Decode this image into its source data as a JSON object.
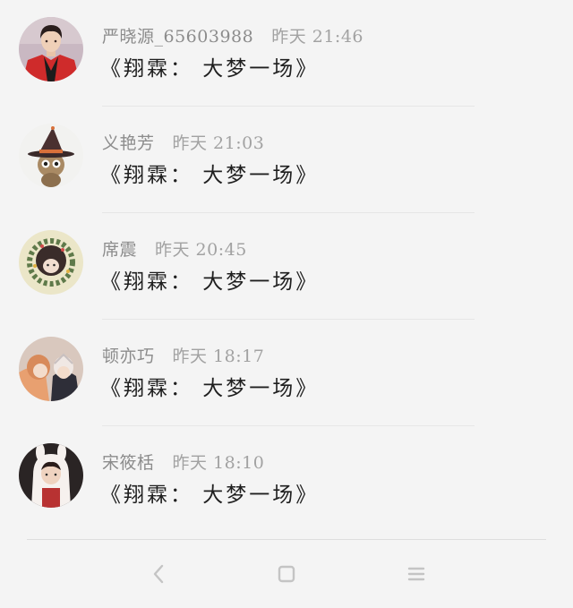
{
  "messages": [
    {
      "username": "严晓源_65603988",
      "time": "昨天 21:46",
      "message": "《翔霖： 大梦一场》"
    },
    {
      "username": "义艳芳",
      "time": "昨天 21:03",
      "message": "《翔霖： 大梦一场》"
    },
    {
      "username": "席震",
      "time": "昨天 20:45",
      "message": "《翔霖： 大梦一场》"
    },
    {
      "username": "顿亦巧",
      "time": "昨天 18:17",
      "message": "《翔霖： 大梦一场》"
    },
    {
      "username": "宋筱栝",
      "time": "昨天 18:10",
      "message": "《翔霖： 大梦一场》"
    }
  ],
  "navbar": {
    "back_icon": "chevron-left-icon",
    "home_icon": "square-home-icon",
    "menu_icon": "hamburger-menu-icon"
  },
  "colors": {
    "background": "#f4f4f4",
    "username": "#8c8c8c",
    "timestamp": "#a2a2a2",
    "message": "#1f1f1f",
    "divider": "#e6e6e6"
  }
}
